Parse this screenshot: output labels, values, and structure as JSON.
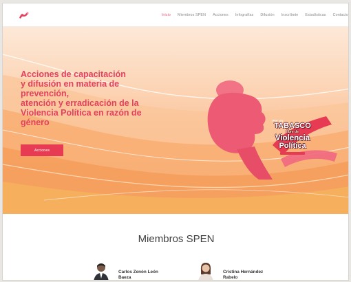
{
  "nav": {
    "logo_icon": "ribbon-logo-icon",
    "items": [
      {
        "label": "Inicio",
        "active": true
      },
      {
        "label": "Miembros SPEN",
        "active": false
      },
      {
        "label": "Acciones",
        "active": false
      },
      {
        "label": "Infografías",
        "active": false
      },
      {
        "label": "Difusión",
        "active": false
      },
      {
        "label": "Inscríbete",
        "active": false
      },
      {
        "label": "Estadísticas",
        "active": false
      },
      {
        "label": "Contacto",
        "active": false
      }
    ]
  },
  "hero": {
    "title": "Acciones de capacitación\ny difusión en materia de\nprevención,\natención y erradicación de la\nViolencia Política en razón de\ngénero",
    "button_label": "Acciones",
    "badge": {
      "line1": "Por un",
      "line2": "TABASCO",
      "line3": "libre de",
      "line4": "Violencia",
      "line5": "Política"
    }
  },
  "members": {
    "title": "Miembros SPEN",
    "items": [
      {
        "name": "Carlos Zenón León\nBaeza"
      },
      {
        "name": "Cristina Hernández\nRabelo"
      }
    ]
  },
  "colors": {
    "accent": "#e4405f",
    "button": "#e63b52",
    "hero_bg": "#fcd3b3"
  }
}
